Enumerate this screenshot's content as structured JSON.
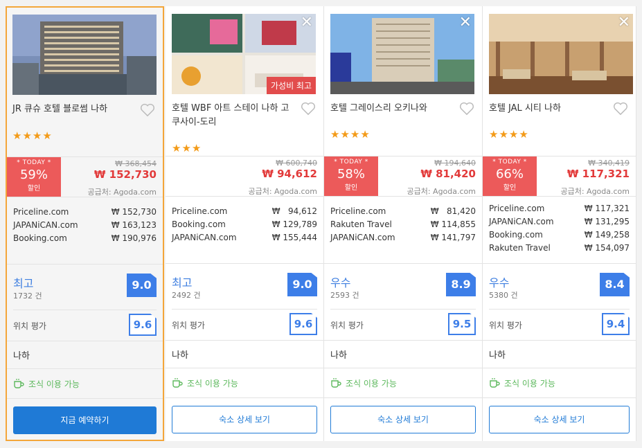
{
  "cards": [
    {
      "name": "JR 큐슈 호텔 블로썸 나하",
      "stars": "★★★★",
      "has_today": true,
      "today_label": "* TODAY *",
      "discount": "59%",
      "discount_label": "할인",
      "original_price": "₩ 368,454",
      "final_price": "₩ 152,730",
      "supplier": "공급처: Agoda.com",
      "offers": [
        {
          "site": "Priceline.com",
          "price": "₩ 152,730"
        },
        {
          "site": "JAPANiCAN.com",
          "price": "₩ 163,123"
        },
        {
          "site": "Booking.com",
          "price": "₩ 190,976"
        }
      ],
      "rating_word": "최고",
      "review_count": "1732 건",
      "score": "9.0",
      "location_label": "위치 평가",
      "location_score": "9.6",
      "area": "나하",
      "breakfast": "조식 이용 가능",
      "button": "지금 예약하기"
    },
    {
      "name": "호텔 WBF 아트 스테이 나하 고쿠사이-도리",
      "stars": "★★★",
      "has_today": false,
      "badge": "가성비 최고",
      "original_price": "₩ 600,740",
      "final_price": "₩ 94,612",
      "supplier": "공급처: Agoda.com",
      "offers": [
        {
          "site": "Priceline.com",
          "price": "₩   94,612"
        },
        {
          "site": "Booking.com",
          "price": "₩ 129,789"
        },
        {
          "site": "JAPANiCAN.com",
          "price": "₩ 155,444"
        }
      ],
      "rating_word": "최고",
      "review_count": "2492 건",
      "score": "9.0",
      "location_label": "위치 평가",
      "location_score": "9.6",
      "area": "나하",
      "breakfast": "조식 이용 가능",
      "button": "숙소 상세 보기"
    },
    {
      "name": "호텔 그레이스리 오키나와",
      "stars": "★★★★",
      "has_today": true,
      "today_label": "* TODAY *",
      "discount": "58%",
      "discount_label": "할인",
      "original_price": "₩ 194,640",
      "final_price": "₩ 81,420",
      "supplier": "공급처: Agoda.com",
      "offers": [
        {
          "site": "Priceline.com",
          "price": "₩   81,420"
        },
        {
          "site": "Rakuten Travel",
          "price": "₩ 114,855"
        },
        {
          "site": "JAPANiCAN.com",
          "price": "₩ 141,797"
        }
      ],
      "rating_word": "우수",
      "review_count": "2593 건",
      "score": "8.9",
      "location_label": "위치 평가",
      "location_score": "9.5",
      "area": "나하",
      "breakfast": "조식 이용 가능",
      "button": "숙소 상세 보기"
    },
    {
      "name": "호텔 JAL 시티 나하",
      "stars": "★★★★",
      "has_today": true,
      "today_label": "* TODAY *",
      "discount": "66%",
      "discount_label": "할인",
      "original_price": "₩ 340,419",
      "final_price": "₩ 117,321",
      "supplier": "공급처: Agoda.com",
      "offers": [
        {
          "site": "Priceline.com",
          "price": "₩ 117,321"
        },
        {
          "site": "JAPANiCAN.com",
          "price": "₩ 131,295"
        },
        {
          "site": "Booking.com",
          "price": "₩ 149,258"
        },
        {
          "site": "Rakuten Travel",
          "price": "₩ 154,097"
        }
      ],
      "rating_word": "우수",
      "review_count": "5380 건",
      "score": "8.4",
      "location_label": "위치 평가",
      "location_score": "9.4",
      "area": "나하",
      "breakfast": "조식 이용 가능",
      "button": "숙소 상세 보기"
    }
  ],
  "colors": {
    "accent": "#1f7ad6",
    "price_red": "#e23a3a",
    "today_red": "#ec5a5a",
    "score_blue": "#3d7ee8",
    "star": "#f39b19",
    "breakfast_green": "#5cb85c",
    "selected_border": "#f4a63a"
  }
}
